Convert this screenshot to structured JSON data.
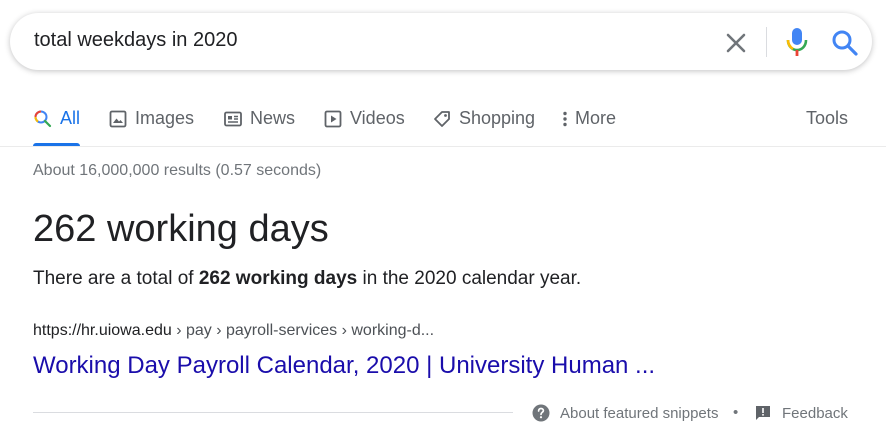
{
  "search": {
    "query": "total weekdays in 2020"
  },
  "tabs": [
    {
      "label": "All",
      "icon": "search-icon",
      "active": true
    },
    {
      "label": "Images",
      "icon": "image-icon"
    },
    {
      "label": "News",
      "icon": "news-icon"
    },
    {
      "label": "Videos",
      "icon": "play-icon"
    },
    {
      "label": "Shopping",
      "icon": "tag-icon"
    },
    {
      "label": "More",
      "icon": "more-vertical-icon"
    }
  ],
  "tools_label": "Tools",
  "result_stats": "About 16,000,000 results (0.57 seconds)",
  "featured_snippet": {
    "answer": "262 working days",
    "text_before": "There are a total of ",
    "text_bold": "262 working days",
    "text_after": " in the 2020 calendar year.",
    "cite_domain": "https://hr.uiowa.edu",
    "cite_path": " › pay › payroll-services › working-d...",
    "title": "Working Day Payroll Calendar, 2020 | University Human ..."
  },
  "footer": {
    "about_label": "About featured snippets",
    "separator": "•",
    "feedback_label": "Feedback"
  },
  "colors": {
    "link": "#1a0dab",
    "active_tab": "#1a73e8",
    "muted": "#70757a"
  }
}
